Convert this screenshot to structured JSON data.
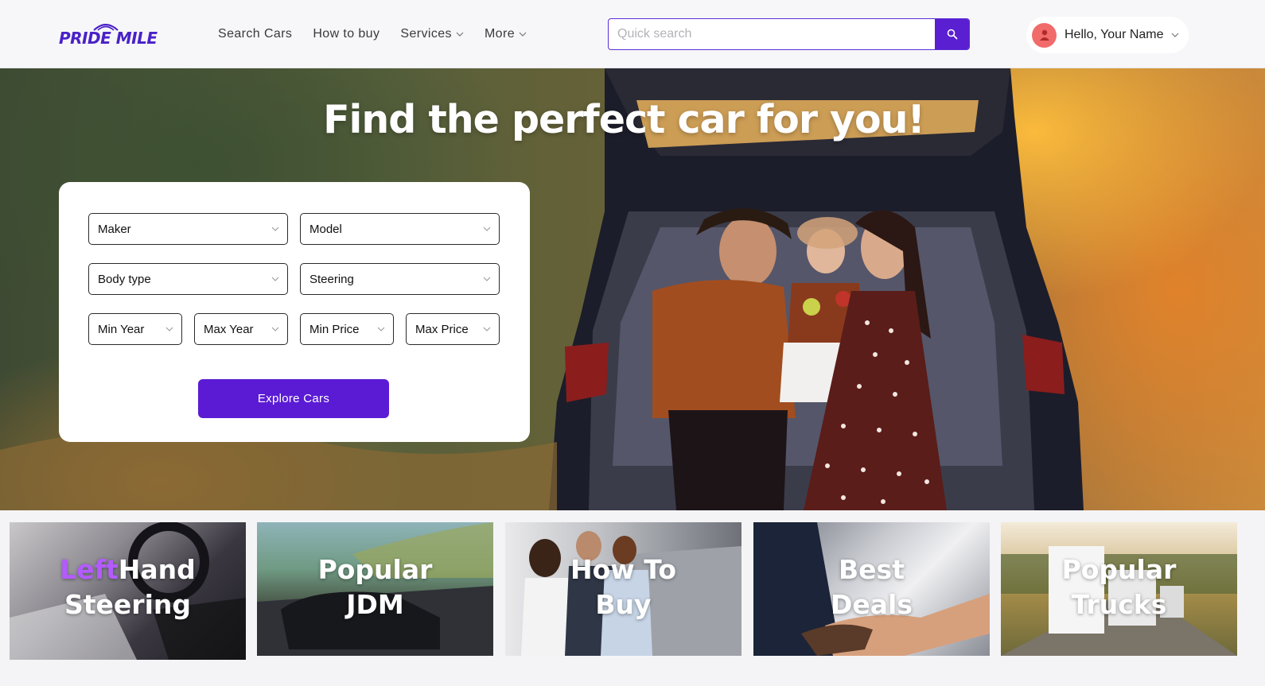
{
  "brand": {
    "name": "PRIDE MILE",
    "accent_color": "#5a1fd1"
  },
  "nav": {
    "items": [
      {
        "label": "Search Cars",
        "has_dropdown": false
      },
      {
        "label": "How to buy",
        "has_dropdown": false
      },
      {
        "label": "Services",
        "has_dropdown": true
      },
      {
        "label": "More",
        "has_dropdown": true
      }
    ]
  },
  "search": {
    "placeholder": "Quick search",
    "value": "",
    "icon": "search-icon"
  },
  "user": {
    "greeting": "Hello, Your Name",
    "avatar_icon": "user-icon",
    "avatar_color": "#f16b6b"
  },
  "hero": {
    "title": "Find the perfect car for you!",
    "filters": {
      "maker": "Maker",
      "model": "Model",
      "body_type": "Body type",
      "steering": "Steering",
      "min_year": "Min Year",
      "max_year": "Max Year",
      "min_price": "Min Price",
      "max_price": "Max Price"
    },
    "explore_button": "Explore Cars"
  },
  "tiles": [
    {
      "line1_accent": "Left",
      "line1": "Hand",
      "line2": "Steering"
    },
    {
      "line1": "Popular",
      "line2": "JDM"
    },
    {
      "line1": "How To",
      "line2": "Buy"
    },
    {
      "line1": "Best",
      "line2": "Deals"
    },
    {
      "line1": "Popular",
      "line2": "Trucks"
    }
  ]
}
